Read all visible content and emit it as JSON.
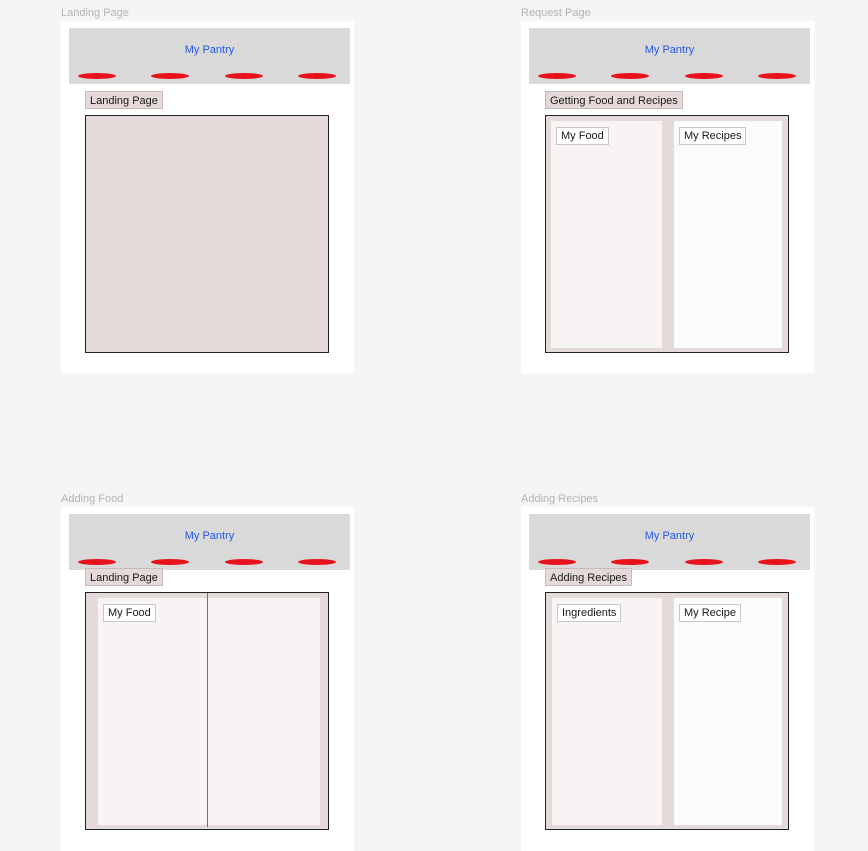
{
  "frames": [
    {
      "label": "Landing Page",
      "header_title": "My Pantry",
      "tag": "Landing Page"
    },
    {
      "label": "Request Page",
      "header_title": "My Pantry",
      "tag": "Getting Food and Recipes",
      "left_panel": "My Food",
      "right_panel": "My Recipes"
    },
    {
      "label": "Adding Food",
      "header_title": "My Pantry",
      "tag": "Landing Page",
      "panel_chip": "My Food"
    },
    {
      "label": "Adding Recipes",
      "header_title": "My Pantry",
      "tag": "Adding Recipes",
      "left_panel": "Ingredients",
      "right_panel": "My Recipe"
    }
  ],
  "colors": {
    "canvas": "#f5f5f5",
    "header": "#d9d9d9",
    "title": "#2457e6",
    "nav": "#e8121c",
    "content": "#e5dada"
  }
}
